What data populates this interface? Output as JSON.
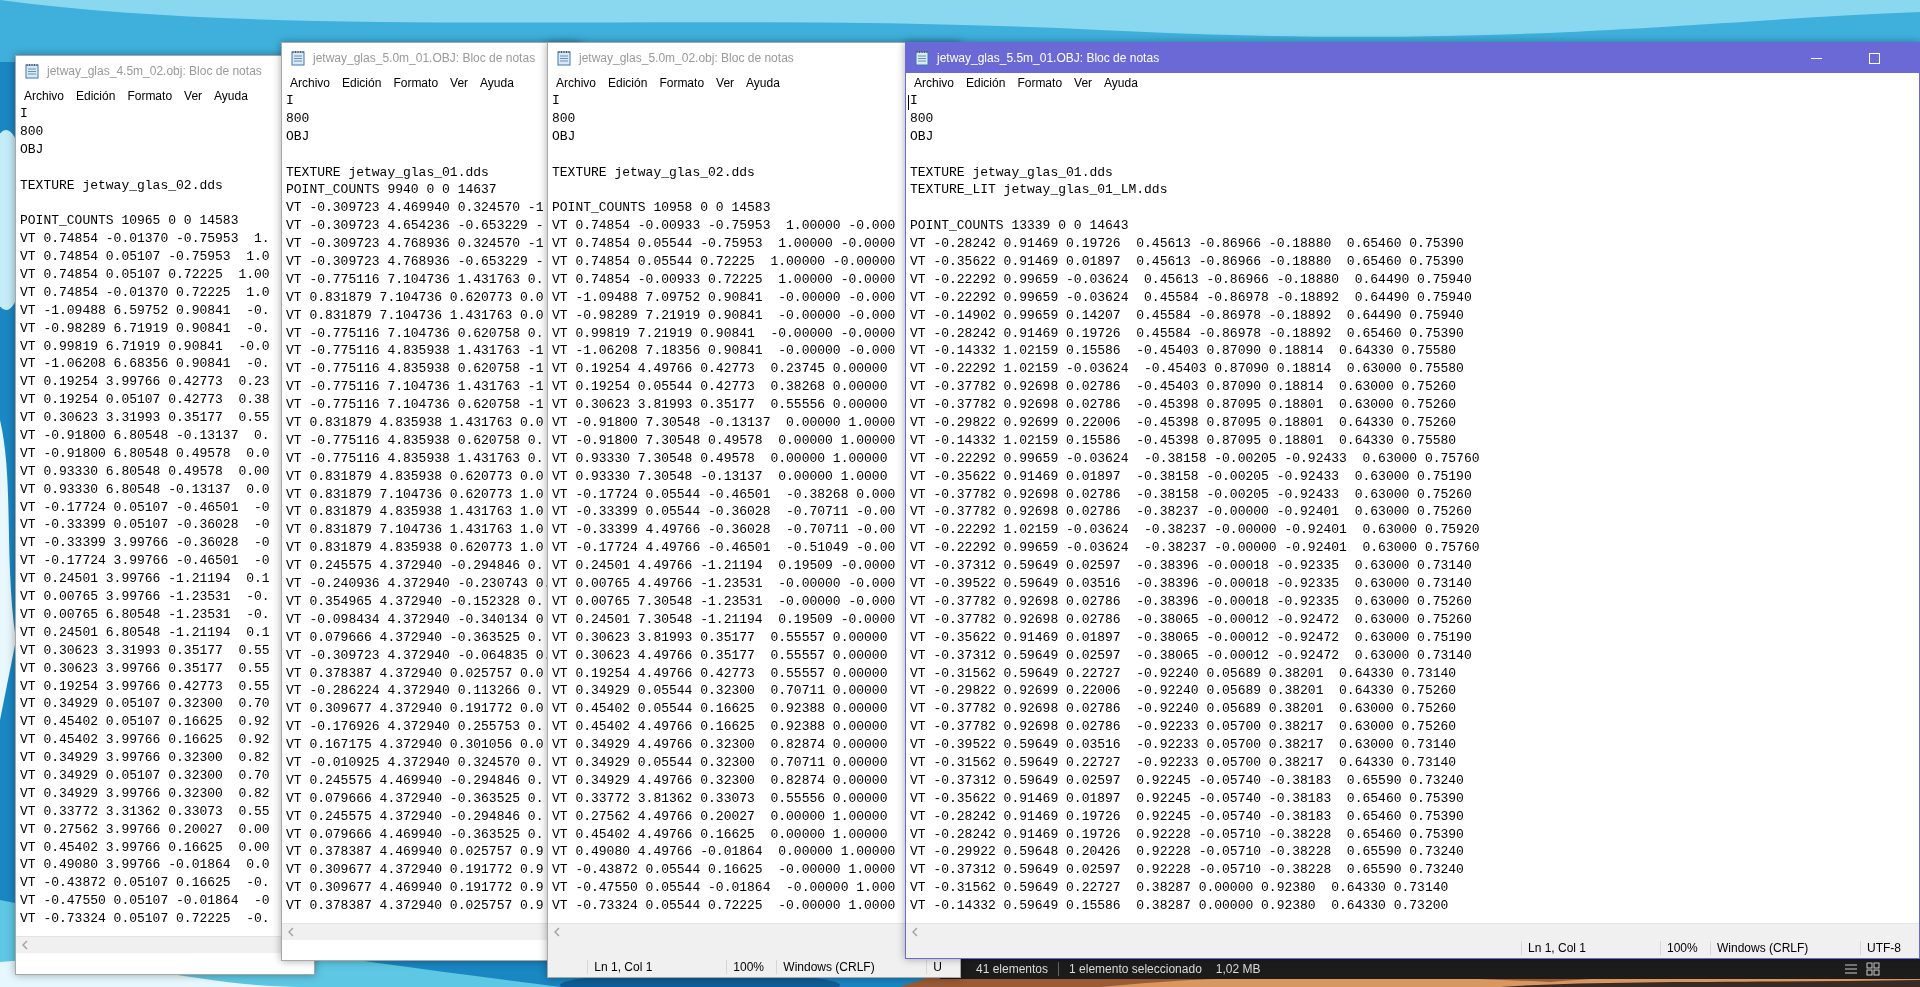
{
  "windows": [
    {
      "title": "jetway_glas_4.5m_02.obj: Bloc de notas",
      "active": false,
      "menu": [
        "Archivo",
        "Edición",
        "Formato",
        "Ver",
        "Ayuda"
      ],
      "paragraphs": [
        [
          "I",
          "800",
          "OBJ"
        ],
        [
          "TEXTURE jetway_glas_02.dds"
        ],
        [
          "POINT_COUNTS 10965 0 0 14583",
          "VT 0.74854 -0.01370 -0.75953  1.",
          "VT 0.74854 0.05107 -0.75953  1.0",
          "VT 0.74854 0.05107 0.72225  1.00",
          "VT 0.74854 -0.01370 0.72225  1.0",
          "VT -1.09488 6.59752 0.90841  -0.",
          "VT -0.98289 6.71919 0.90841  -0.",
          "VT 0.99819 6.71919 0.90841  -0.0",
          "VT -1.06208 6.68356 0.90841  -0.",
          "VT 0.19254 3.99766 0.42773  0.23",
          "VT 0.19254 0.05107 0.42773  0.38",
          "VT 0.30623 3.31993 0.35177  0.55",
          "VT -0.91800 6.80548 -0.13137  0.",
          "VT -0.91800 6.80548 0.49578  0.0",
          "VT 0.93330 6.80548 0.49578  0.00",
          "VT 0.93330 6.80548 -0.13137  0.0",
          "VT -0.17724 0.05107 -0.46501  -0",
          "VT -0.33399 0.05107 -0.36028  -0",
          "VT -0.33399 3.99766 -0.36028  -0",
          "VT -0.17724 3.99766 -0.46501  -0",
          "VT 0.24501 3.99766 -1.21194  0.1",
          "VT 0.00765 3.99766 -1.23531  -0.",
          "VT 0.00765 6.80548 -1.23531  -0.",
          "VT 0.24501 6.80548 -1.21194  0.1",
          "VT 0.30623 3.31993 0.35177  0.55",
          "VT 0.30623 3.99766 0.35177  0.55",
          "VT 0.19254 3.99766 0.42773  0.55",
          "VT 0.34929 0.05107 0.32300  0.70",
          "VT 0.45402 0.05107 0.16625  0.92",
          "VT 0.45402 3.99766 0.16625  0.92",
          "VT 0.34929 3.99766 0.32300  0.82",
          "VT 0.34929 0.05107 0.32300  0.70",
          "VT 0.34929 3.99766 0.32300  0.82",
          "VT 0.33772 3.31362 0.33073  0.55",
          "VT 0.27562 3.99766 0.20027  0.00",
          "VT 0.45402 3.99766 0.16625  0.00",
          "VT 0.49080 3.99766 -0.01864  0.0",
          "VT -0.43872 0.05107 0.16625  -0.",
          "VT -0.47550 0.05107 -0.01864  -0",
          "VT -0.73324 0.05107 0.72225  -0."
        ]
      ]
    },
    {
      "title": "jetway_glas_5.0m_01.OBJ: Bloc de notas",
      "active": false,
      "menu": [
        "Archivo",
        "Edición",
        "Formato",
        "Ver",
        "Ayuda"
      ],
      "paragraphs": [
        [
          "I",
          "800",
          "OBJ"
        ],
        [
          "TEXTURE jetway_glas_01.dds",
          "POINT_COUNTS 9940 0 0 14637",
          "VT -0.309723 4.469940 0.324570 -1",
          "VT -0.309723 4.654236 -0.653229 -",
          "VT -0.309723 4.768936 0.324570 -1",
          "VT -0.309723 4.768936 -0.653229 -",
          "VT -0.775116 7.104736 1.431763 0.",
          "VT 0.831879 7.104736 0.620773 0.0",
          "VT 0.831879 7.104736 1.431763 0.0",
          "VT -0.775116 7.104736 0.620758 0.",
          "VT -0.775116 4.835938 1.431763 -1",
          "VT -0.775116 4.835938 0.620758 -1",
          "VT -0.775116 7.104736 1.431763 -1",
          "VT -0.775116 7.104736 0.620758 -1",
          "VT 0.831879 4.835938 1.431763 0.0",
          "VT -0.775116 4.835938 0.620758 0.",
          "VT -0.775116 4.835938 1.431763 0.",
          "VT 0.831879 4.835938 0.620773 0.0",
          "VT 0.831879 7.104736 0.620773 1.0",
          "VT 0.831879 4.835938 1.431763 1.0",
          "VT 0.831879 7.104736 1.431763 1.0",
          "VT 0.831879 4.835938 0.620773 1.0",
          "VT 0.245575 4.372940 -0.294846 0.",
          "VT -0.240936 4.372940 -0.230743 0.",
          "VT 0.354965 4.372940 -0.152328 0.",
          "VT -0.098434 4.372940 -0.340134 0",
          "VT 0.079666 4.372940 -0.363525 0.",
          "VT -0.309723 4.372940 -0.064835 0.",
          "VT 0.378387 4.372940 0.025757 0.0",
          "VT -0.286224 4.372940 0.113266 0.",
          "VT 0.309677 4.372940 0.191772 0.0",
          "VT -0.176926 4.372940 0.255753 0.",
          "VT 0.167175 4.372940 0.301056 0.0",
          "VT -0.010925 4.372940 0.324570 0.",
          "VT 0.245575 4.469940 -0.294846 0.",
          "VT 0.079666 4.372940 -0.363525 0.",
          "VT 0.245575 4.372940 -0.294846 0.",
          "VT 0.079666 4.469940 -0.363525 0.",
          "VT 0.378387 4.469940 0.025757 0.9",
          "VT 0.309677 4.372940 0.191772 0.9",
          "VT 0.309677 4.469940 0.191772 0.9",
          "VT 0.378387 4.372940 0.025757 0.9"
        ]
      ]
    },
    {
      "title": "jetway_glas_5.0m_02.obj: Bloc de notas",
      "active": false,
      "menu": [
        "Archivo",
        "Edición",
        "Formato",
        "Ver",
        "Ayuda"
      ],
      "paragraphs": [
        [
          "I",
          "800",
          "OBJ"
        ],
        [
          "TEXTURE jetway_glas_02.dds"
        ],
        [
          "POINT_COUNTS 10958 0 0 14583",
          "VT 0.74854 -0.00933 -0.75953  1.00000 -0.000",
          "VT 0.74854 0.05544 -0.75953  1.00000 -0.0000",
          "VT 0.74854 0.05544 0.72225  1.00000 -0.00000",
          "VT 0.74854 -0.00933 0.72225  1.00000 -0.0000",
          "VT -1.09488 7.09752 0.90841  -0.00000 -0.000",
          "VT -0.98289 7.21919 0.90841  -0.00000 -0.000",
          "VT 0.99819 7.21919 0.90841  -0.00000 -0.0000",
          "VT -1.06208 7.18356 0.90841  -0.00000 -0.000",
          "VT 0.19254 4.49766 0.42773  0.23745 0.00000",
          "VT 0.19254 0.05544 0.42773  0.38268 0.00000",
          "VT 0.30623 3.81993 0.35177  0.55556 0.00000",
          "VT -0.91800 7.30548 -0.13137  0.00000 1.0000",
          "VT -0.91800 7.30548 0.49578  0.00000 1.00000",
          "VT 0.93330 7.30548 0.49578  0.00000 1.00000",
          "VT 0.93330 7.30548 -0.13137  0.00000 1.0000",
          "VT -0.17724 0.05544 -0.46501  -0.38268 0.000",
          "VT -0.33399 0.05544 -0.36028  -0.70711 -0.00",
          "VT -0.33399 4.49766 -0.36028  -0.70711 -0.00",
          "VT -0.17724 4.49766 -0.46501  -0.51049 -0.00",
          "VT 0.24501 4.49766 -1.21194  0.19509 -0.0000",
          "VT 0.00765 4.49766 -1.23531  -0.00000 -0.000",
          "VT 0.00765 7.30548 -1.23531  -0.00000 -0.000",
          "VT 0.24501 7.30548 -1.21194  0.19509 -0.0000",
          "VT 0.30623 3.81993 0.35177  0.55557 0.00000",
          "VT 0.30623 4.49766 0.35177  0.55557 0.00000",
          "VT 0.19254 4.49766 0.42773  0.55557 0.00000",
          "VT 0.34929 0.05544 0.32300  0.70711 0.00000",
          "VT 0.45402 0.05544 0.16625  0.92388 0.00000",
          "VT 0.45402 4.49766 0.16625  0.92388 0.00000",
          "VT 0.34929 4.49766 0.32300  0.82874 0.00000",
          "VT 0.34929 0.05544 0.32300  0.70711 0.00000",
          "VT 0.34929 4.49766 0.32300  0.82874 0.00000",
          "VT 0.33772 3.81362 0.33073  0.55556 0.00000",
          "VT 0.27562 4.49766 0.20027  0.00000 1.00000",
          "VT 0.45402 4.49766 0.16625  0.00000 1.00000",
          "VT 0.49080 4.49766 -0.01864  0.00000 1.00000",
          "VT -0.43872 0.05544 0.16625  -0.00000 1.0000",
          "VT -0.47550 0.05544 -0.01864  -0.00000 1.000",
          "VT -0.73324 0.05544 0.72225  -0.00000 1.0000"
        ]
      ],
      "status_bar": [
        "Ln 1, Col 1",
        "100%",
        "Windows (CRLF)",
        "U"
      ]
    },
    {
      "title": "jetway_glas_5.5m_01.OBJ: Bloc de notas",
      "active": true,
      "caret": true,
      "menu": [
        "Archivo",
        "Edición",
        "Formato",
        "Ver",
        "Ayuda"
      ],
      "paragraphs": [
        [
          "I",
          "800",
          "OBJ"
        ],
        [
          "TEXTURE jetway_glas_01.dds",
          "TEXTURE_LIT jetway_glas_01_LM.dds"
        ],
        [
          "POINT_COUNTS 13339 0 0 14643",
          "VT -0.28242 0.91469 0.19726  0.45613 -0.86966 -0.18880  0.65460 0.75390",
          "VT -0.35622 0.91469 0.01897  0.45613 -0.86966 -0.18880  0.65460 0.75390",
          "VT -0.22292 0.99659 -0.03624  0.45613 -0.86966 -0.18880  0.64490 0.75940",
          "VT -0.22292 0.99659 -0.03624  0.45584 -0.86978 -0.18892  0.64490 0.75940",
          "VT -0.14902 0.99659 0.14207  0.45584 -0.86978 -0.18892  0.64490 0.75940",
          "VT -0.28242 0.91469 0.19726  0.45584 -0.86978 -0.18892  0.65460 0.75390",
          "VT -0.14332 1.02159 0.15586  -0.45403 0.87090 0.18814  0.64330 0.75580",
          "VT -0.22292 1.02159 -0.03624  -0.45403 0.87090 0.18814  0.63000 0.75580",
          "VT -0.37782 0.92698 0.02786  -0.45403 0.87090 0.18814  0.63000 0.75260",
          "VT -0.37782 0.92698 0.02786  -0.45398 0.87095 0.18801  0.63000 0.75260",
          "VT -0.29822 0.92699 0.22006  -0.45398 0.87095 0.18801  0.64330 0.75260",
          "VT -0.14332 1.02159 0.15586  -0.45398 0.87095 0.18801  0.64330 0.75580",
          "VT -0.22292 0.99659 -0.03624  -0.38158 -0.00205 -0.92433  0.63000 0.75760",
          "VT -0.35622 0.91469 0.01897  -0.38158 -0.00205 -0.92433  0.63000 0.75190",
          "VT -0.37782 0.92698 0.02786  -0.38158 -0.00205 -0.92433  0.63000 0.75260",
          "VT -0.37782 0.92698 0.02786  -0.38237 -0.00000 -0.92401  0.63000 0.75260",
          "VT -0.22292 1.02159 -0.03624  -0.38237 -0.00000 -0.92401  0.63000 0.75920",
          "VT -0.22292 0.99659 -0.03624  -0.38237 -0.00000 -0.92401  0.63000 0.75760",
          "VT -0.37312 0.59649 0.02597  -0.38396 -0.00018 -0.92335  0.63000 0.73140",
          "VT -0.39522 0.59649 0.03516  -0.38396 -0.00018 -0.92335  0.63000 0.73140",
          "VT -0.37782 0.92698 0.02786  -0.38396 -0.00018 -0.92335  0.63000 0.75260",
          "VT -0.37782 0.92698 0.02786  -0.38065 -0.00012 -0.92472  0.63000 0.75260",
          "VT -0.35622 0.91469 0.01897  -0.38065 -0.00012 -0.92472  0.63000 0.75190",
          "VT -0.37312 0.59649 0.02597  -0.38065 -0.00012 -0.92472  0.63000 0.73140",
          "VT -0.31562 0.59649 0.22727  -0.92240 0.05689 0.38201  0.64330 0.73140",
          "VT -0.29822 0.92699 0.22006  -0.92240 0.05689 0.38201  0.64330 0.75260",
          "VT -0.37782 0.92698 0.02786  -0.92240 0.05689 0.38201  0.63000 0.75260",
          "VT -0.37782 0.92698 0.02786  -0.92233 0.05700 0.38217  0.63000 0.75260",
          "VT -0.39522 0.59649 0.03516  -0.92233 0.05700 0.38217  0.63000 0.73140",
          "VT -0.31562 0.59649 0.22727  -0.92233 0.05700 0.38217  0.64330 0.73140",
          "VT -0.37312 0.59649 0.02597  0.92245 -0.05740 -0.38183  0.65590 0.73240",
          "VT -0.35622 0.91469 0.01897  0.92245 -0.05740 -0.38183  0.65460 0.75390",
          "VT -0.28242 0.91469 0.19726  0.92245 -0.05740 -0.38183  0.65460 0.75390",
          "VT -0.28242 0.91469 0.19726  0.92228 -0.05710 -0.38228  0.65460 0.75390",
          "VT -0.29922 0.59648 0.20426  0.92228 -0.05710 -0.38228  0.65590 0.73240",
          "VT -0.37312 0.59649 0.02597  0.92228 -0.05710 -0.38228  0.65590 0.73240",
          "VT -0.31562 0.59649 0.22727  0.38287 0.00000 0.92380  0.64330 0.73140",
          "VT -0.14332 0.59649 0.15586  0.38287 0.00000 0.92380  0.64330 0.73200"
        ]
      ],
      "status_bar": [
        "Ln 1, Col 1",
        "100%",
        "Windows (CRLF)",
        "UTF-8"
      ]
    }
  ],
  "explorer_status_bar": [
    "41 elementos",
    "1 elemento seleccionado",
    "1,02 MB"
  ]
}
